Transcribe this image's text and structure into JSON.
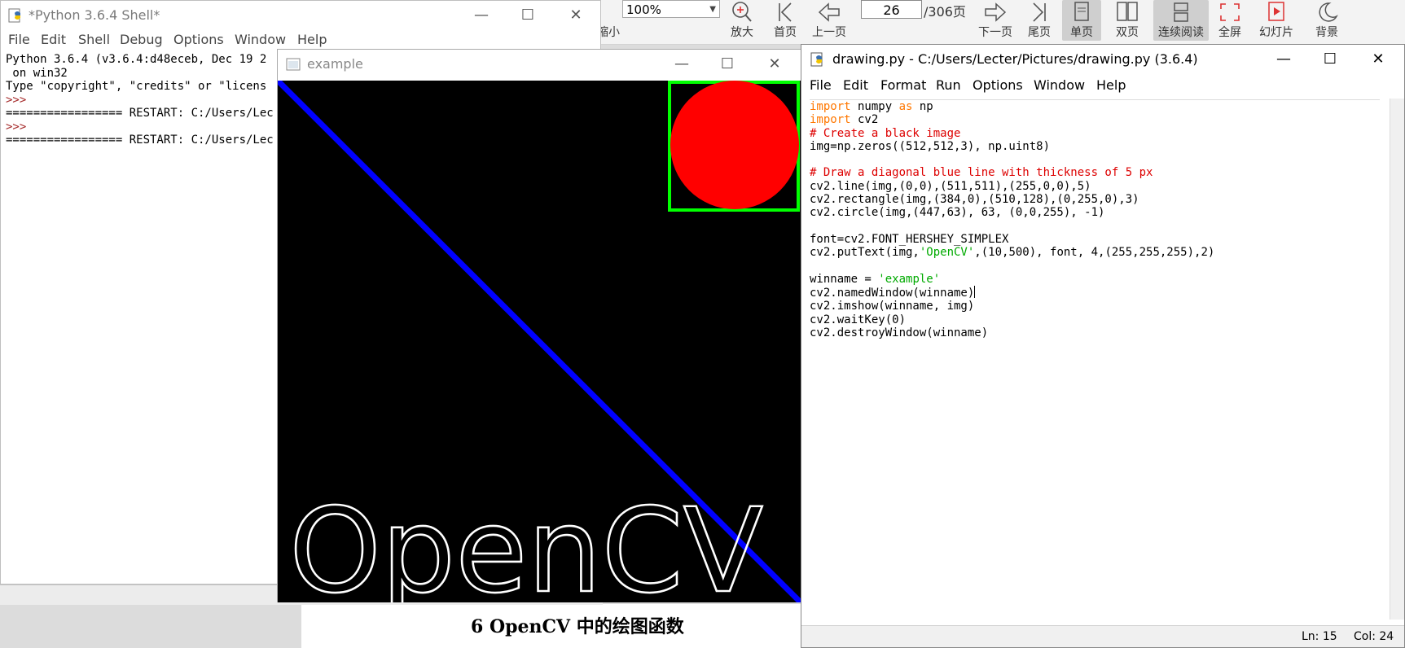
{
  "pdf_toolbar": {
    "zoom_value": "100%",
    "zoom_out_label": "缩小",
    "zoom_in_label": "放大",
    "first_page_label": "首页",
    "prev_page_label": "上一页",
    "current_page": "26",
    "total_pages": "/306页",
    "next_page_label": "下一页",
    "last_page_label": "尾页",
    "single_page_label": "单页",
    "double_page_label": "双页",
    "continuous_label": "连续阅读",
    "fullscreen_label": "全屏",
    "slideshow_label": "幻灯片",
    "background_label": "背景"
  },
  "shell_window": {
    "title": "*Python 3.6.4 Shell*",
    "menu": [
      "File",
      "Edit",
      "Shell",
      "Debug",
      "Options",
      "Window",
      "Help"
    ],
    "lines": [
      "Python 3.6.4 (v3.6.4:d48eceb, Dec 19 2",
      " on win32",
      "Type \"copyright\", \"credits\" or \"licens",
      ">>> ",
      "================= RESTART: C:/Users/Lec",
      ">>> ",
      "================= RESTART: C:/Users/Lec"
    ]
  },
  "example_window": {
    "title": "example",
    "image_text": "OpenCV",
    "colors": {
      "line": "#0000ff",
      "rectangle": "#00ff00",
      "circle": "#ff0000",
      "text": "#ffffff",
      "background": "#000000"
    }
  },
  "editor_window": {
    "title": "drawing.py - C:/Users/Lecter/Pictures/drawing.py (3.6.4)",
    "menu": [
      "File",
      "Edit",
      "Format",
      "Run",
      "Options",
      "Window",
      "Help"
    ],
    "code": {
      "l1_kw1": "import",
      "l1_rest1": " numpy ",
      "l1_kw2": "as",
      "l1_rest2": " np",
      "l2_kw": "import",
      "l2_rest": " cv2",
      "l3": "# Create a black image",
      "l4": "img=np.zeros((512,512,3), np.uint8)",
      "l5": "",
      "l6": "# Draw a diagonal blue line with thickness of 5 px",
      "l7": "cv2.line(img,(0,0),(511,511),(255,0,0),5)",
      "l8": "cv2.rectangle(img,(384,0),(510,128),(0,255,0),3)",
      "l9": "cv2.circle(img,(447,63), 63, (0,0,255), -1)",
      "l10": "",
      "l11": "font=cv2.FONT_HERSHEY_SIMPLEX",
      "l12_a": "cv2.putText(img,",
      "l12_str": "'OpenCV'",
      "l12_b": ",(10,500), font, 4,(255,255,255),2)",
      "l13": "",
      "l14_a": "winname = ",
      "l14_str": "'example'",
      "l15": "cv2.namedWindow(winname)",
      "l16": "cv2.imshow(winname, img)",
      "l17": "cv2.waitKey(0)",
      "l18": "cv2.destroyWindow(winname)"
    },
    "status_line": "Ln: 15",
    "status_col": "Col: 24"
  },
  "pdf_page": {
    "heading": "6   OpenCV 中的绘图函数"
  }
}
